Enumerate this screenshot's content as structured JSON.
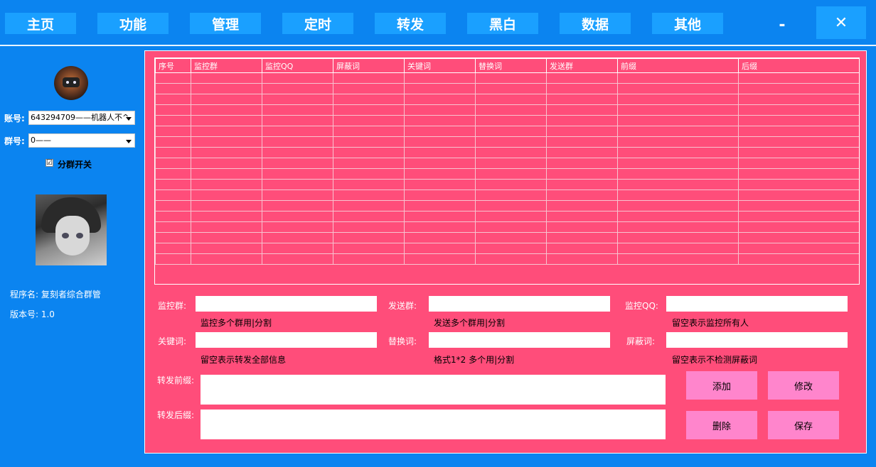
{
  "nav": {
    "items": [
      "主页",
      "功能",
      "管理",
      "定时",
      "转发",
      "黑白",
      "数据",
      "其他"
    ],
    "minimize": "-",
    "close": "✕"
  },
  "sidebar": {
    "account_label": "账号:",
    "account_value": "643294709——机器人不^",
    "group_label": "群号:",
    "group_value": "0——",
    "split_checked": "☑",
    "split_label": "分群开关",
    "program_name": "程序名: 复刻者综合群管",
    "version": "版本号: 1.0"
  },
  "grid": {
    "columns": [
      "序号",
      "监控群",
      "监控QQ",
      "屏蔽词",
      "关键词",
      "替换词",
      "发送群",
      "前缀",
      "后缀"
    ],
    "empty_rows": 18
  },
  "form": {
    "monitor_group_label": "监控群:",
    "monitor_group_hint": "监控多个群用|分割",
    "send_group_label": "发送群:",
    "send_group_hint": "发送多个群用|分割",
    "monitor_qq_label": "监控QQ:",
    "monitor_qq_hint": "留空表示监控所有人",
    "keyword_label": "关键词:",
    "keyword_hint": "留空表示转发全部信息",
    "replace_label": "替换词:",
    "replace_hint": "格式1*2 多个用|分割",
    "block_label": "屏蔽词:",
    "block_hint": "留空表示不检测屏蔽词",
    "prefix_label": "转发前缀:",
    "suffix_label": "转发后缀:"
  },
  "actions": {
    "add": "添加",
    "edit": "修改",
    "delete": "删除",
    "save": "保存"
  },
  "colors": {
    "background": "#0b84f0",
    "nav_button": "#1aa0ff",
    "panel": "#ff4d7a",
    "action_button": "#ff85cc"
  }
}
